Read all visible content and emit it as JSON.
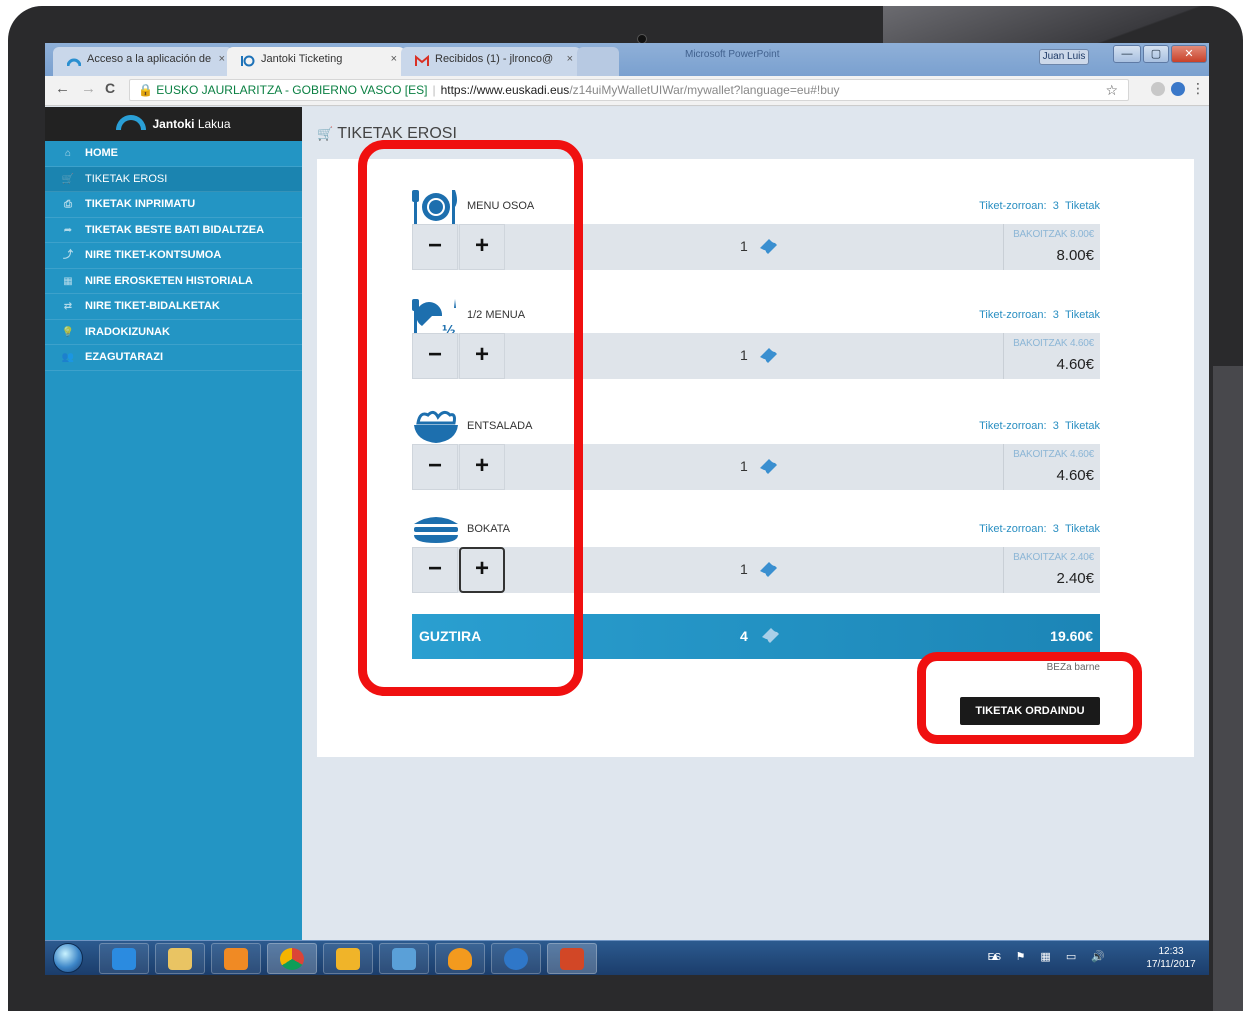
{
  "browser": {
    "tabs": [
      {
        "label": "Acceso a la aplicación de",
        "close": "×"
      },
      {
        "label": "Jantoki Ticketing",
        "close": "×"
      },
      {
        "label": "Recibidos (1) - jlronco@",
        "close": "×"
      }
    ],
    "window_title_fragment": "Microsoft PowerPoint",
    "user": "Juan Luis",
    "win_minimize": "—",
    "win_maximize": "▢",
    "win_close": "✕",
    "back": "←",
    "forward": "→",
    "reload": "C",
    "secure_label": "🔒 EUSKO JAURLARITZA - GOBIERNO VASCO [ES]",
    "url_host": "https://www.euskadi.eus",
    "url_path": "/z14uiMyWalletUIWar/mywallet?language=eu#!buy",
    "star": "☆",
    "menu": "⋮"
  },
  "app": {
    "brand_bold": "Jantoki",
    "brand_rest": "Lakua",
    "sidebar": [
      {
        "label": "HOME",
        "icon": "⌂"
      },
      {
        "label": "TIKETAK EROSI",
        "icon": "🛒"
      },
      {
        "label": "TIKETAK INPRIMATU",
        "icon": "⎙"
      },
      {
        "label": "TIKETAK BESTE BATI BIDALTZEA",
        "icon": "➦"
      },
      {
        "label": "NIRE TIKET-KONTSUMOA",
        "icon": "⤴"
      },
      {
        "label": "NIRE EROSKETEN HISTORIALA",
        "icon": "▦"
      },
      {
        "label": "NIRE TIKET-BIDALKETAK",
        "icon": "⇄"
      },
      {
        "label": "IRADOKIZUNAK",
        "icon": "💡"
      },
      {
        "label": "EZAGUTARAZI",
        "icon": "👥"
      }
    ],
    "page_title": "TIKETAK EROSI",
    "cart_icon": "🛒",
    "products": [
      {
        "name": "MENU OSOA",
        "wallet_label": "Tiket-zorroan:",
        "wallet_count": "3",
        "wallet_unit": "Tiketak",
        "qty": "1",
        "unit_label": "BAKOITZAK 8.00€",
        "price": "8.00€",
        "icon": "plate-fork-knife-icon"
      },
      {
        "name": "1/2 MENUA",
        "wallet_label": "Tiket-zorroan:",
        "wallet_count": "3",
        "wallet_unit": "Tiketak",
        "qty": "1",
        "unit_label": "BAKOITZAK 4.60€",
        "price": "4.60€",
        "icon": "half-menu-icon"
      },
      {
        "name": "ENTSALADA",
        "wallet_label": "Tiket-zorroan:",
        "wallet_count": "3",
        "wallet_unit": "Tiketak",
        "qty": "1",
        "unit_label": "BAKOITZAK 4.60€",
        "price": "4.60€",
        "icon": "salad-bowl-icon"
      },
      {
        "name": "BOKATA",
        "wallet_label": "Tiket-zorroan:",
        "wallet_count": "3",
        "wallet_unit": "Tiketak",
        "qty": "1",
        "unit_label": "BAKOITZAK 2.40€",
        "price": "2.40€",
        "icon": "sandwich-icon"
      }
    ],
    "minus": "−",
    "plus": "+",
    "total_label": "GUZTIRA",
    "total_qty": "4",
    "total_price": "19.60€",
    "vat_note": "BEZa barne",
    "pay_button": "TIKETAK ORDAINDU"
  },
  "taskbar": {
    "lang": "ES",
    "tray_icons": "▲ ⚑ ▦ ▭ 🔊",
    "time": "12:33",
    "date": "17/11/2017"
  },
  "colors": {
    "sidebar": "#2395c4",
    "accent": "#2a8fc2",
    "highlight": "#f01010",
    "total_bar": "#1c85b6"
  }
}
